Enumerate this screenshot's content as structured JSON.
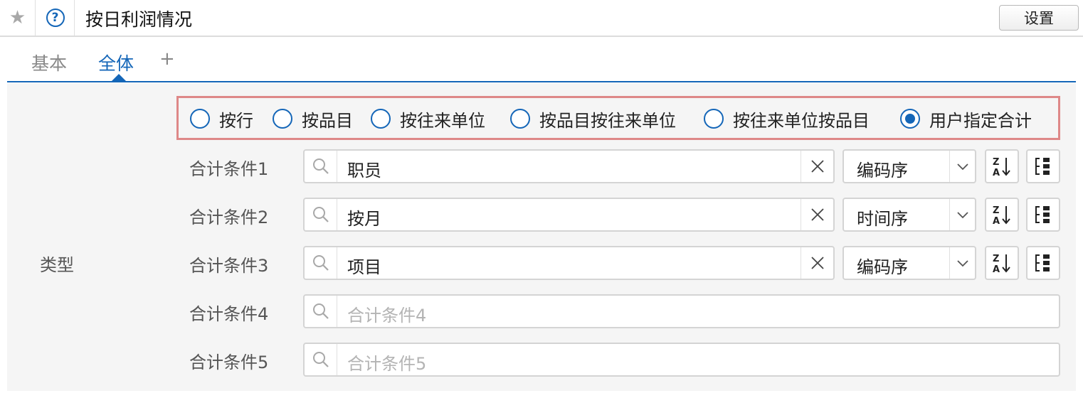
{
  "header": {
    "star_icon": "star-icon",
    "help_glyph": "?",
    "title": "按日利润情况",
    "settings_label": "设置"
  },
  "tabs": [
    {
      "label": "基本",
      "active": false
    },
    {
      "label": "全体",
      "active": true
    },
    {
      "label": "+",
      "active": false
    }
  ],
  "section": {
    "label": "类型",
    "radio_options": [
      {
        "label": "按行",
        "checked": false
      },
      {
        "label": "按品目",
        "checked": false
      },
      {
        "label": "按往来单位",
        "checked": false
      },
      {
        "label": "按品目按往来单位",
        "checked": false
      },
      {
        "label": "按往来单位按品目",
        "checked": false
      },
      {
        "label": "用户指定合计",
        "checked": true
      }
    ],
    "conditions": [
      {
        "label": "合计条件1",
        "value": "职员",
        "placeholder": "",
        "sort": "编码序"
      },
      {
        "label": "合计条件2",
        "value": "按月",
        "placeholder": "",
        "sort": "时间序"
      },
      {
        "label": "合计条件3",
        "value": "项目",
        "placeholder": "",
        "sort": "编码序"
      },
      {
        "label": "合计条件4",
        "value": "",
        "placeholder": "合计条件4",
        "sort": null
      },
      {
        "label": "合计条件5",
        "value": "",
        "placeholder": "合计条件5",
        "sort": null
      }
    ]
  },
  "colors": {
    "accent": "#1466b8",
    "highlight_border": "#de8888",
    "panel_bg": "#f5f5f5"
  }
}
